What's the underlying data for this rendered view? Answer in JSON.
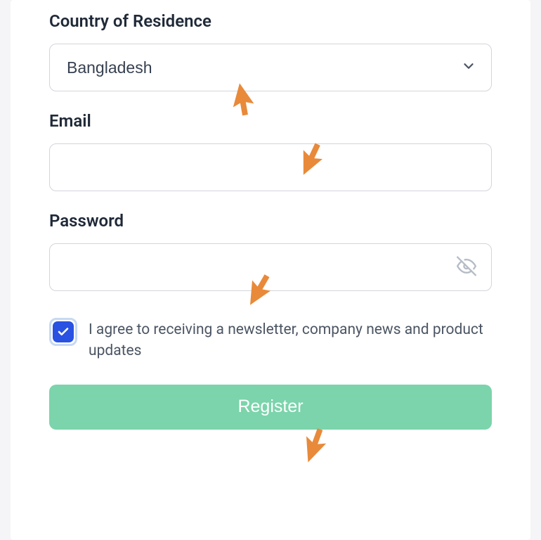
{
  "form": {
    "country": {
      "label": "Country of Residence",
      "selected": "Bangladesh"
    },
    "email": {
      "label": "Email",
      "value": "",
      "placeholder": ""
    },
    "password": {
      "label": "Password",
      "value": "",
      "placeholder": ""
    },
    "newsletter": {
      "checked": true,
      "label": "I agree to receiving a newsletter, company news and product updates"
    },
    "submit": {
      "label": "Register"
    }
  }
}
